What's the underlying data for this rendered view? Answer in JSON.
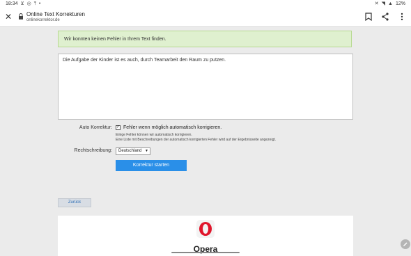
{
  "status_bar": {
    "time": "18:34",
    "battery": "12%"
  },
  "browser": {
    "page_title": "Online Text Korrekturen",
    "url": "onlinekorrektor.de"
  },
  "main": {
    "success_message": "Wir konnten keinen Fehler in Ihrem Text finden.",
    "text_input": "Die Aufgabe der Kinder ist es auch, durch Teamarbeit den Raum zu putzen.",
    "auto_korrektur_label": "Auto Korrektur:",
    "auto_korrektur_checkbox": "Fehler wenn möglich automatisch korrigieren.",
    "auto_korrektur_checked": true,
    "hint_1": "Einige Fehler können wir automatisch korrigieren.",
    "hint_2": "Eine Liste mit Beschreibungen der automatisch korrigierten Fehler wird auf der Ergebnisseite angezeigt.",
    "rechtschreibung_label": "Rechtschreibung:",
    "rechtschreibung_value": "Deutschland",
    "start_button": "Korrektur starten",
    "back_button": "Zurück"
  },
  "ad": {
    "brand": "Opera"
  },
  "colors": {
    "accent": "#2a8fe8",
    "success_bg": "#dff0cf",
    "success_border": "#b6d98f",
    "opera_red": "#e0152b"
  },
  "icons": {
    "close": "close-icon",
    "lock": "lock-icon",
    "bookmark": "bookmark-icon",
    "share": "share-icon",
    "menu": "more-vert-icon",
    "edit": "pencil-icon"
  }
}
